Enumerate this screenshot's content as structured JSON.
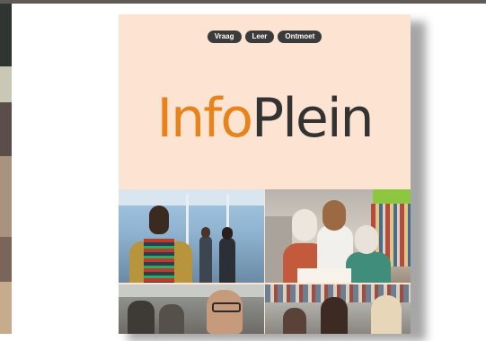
{
  "cover": {
    "pills": [
      "Vraag",
      "Leer",
      "Ontmoet"
    ],
    "logo": {
      "part1": "Info",
      "part2": "Plein"
    }
  },
  "colors": {
    "header_background": "#fde4d2",
    "logo_accent": "#e8821b",
    "logo_dark": "#333333",
    "pill_background": "#3b3b3b"
  },
  "photos": [
    {
      "name": "photo-man-library",
      "subject": "man in striped sweater in library hall"
    },
    {
      "name": "photo-reading-group",
      "subject": "women reading together at table"
    },
    {
      "name": "photo-man-glasses",
      "subject": "man with glasses in group"
    },
    {
      "name": "photo-group-smiling",
      "subject": "people smiling in library"
    }
  ]
}
